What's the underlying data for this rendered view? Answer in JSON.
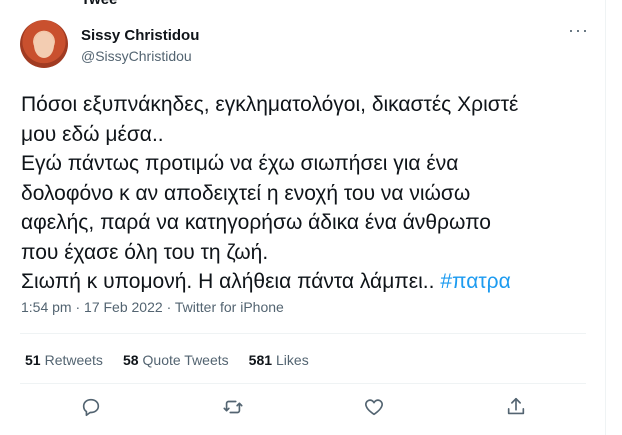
{
  "tweet": {
    "top_cut_text": "Twee",
    "author_name": "Sissy Christidou",
    "author_handle": "@SissyChristidou",
    "body_text": "Πόσοι εξυπνάκηδες, εγκληματολόγοι, δικαστές Χριστέ\nμου εδώ μέσα..\nΕγώ πάντως προτιμώ να έχω σιωπήσει για ένα\nδολοφόνο κ αν αποδειχτεί η ενοχή του να νιώσω\nαφελής, παρά να κατηγορήσω άδικα ένα άνθρωπο\nπου έχασε όλη του τη ζωή.\nΣιωπή κ υπομονή. Η αλήθεια πάντα λάμπει.. ",
    "hashtag": "#πατρα",
    "time": "1:54 pm",
    "separator": "·",
    "date": "17 Feb 2022",
    "source": "Twitter for iPhone",
    "more_glyph": "···"
  },
  "stats": {
    "retweets_count": "51",
    "retweets_label": "Retweets",
    "quotes_count": "58",
    "quotes_label": "Quote Tweets",
    "likes_count": "581",
    "likes_label": "Likes"
  },
  "actions": {
    "icons": [
      "reply-icon",
      "retweet-icon",
      "like-icon",
      "share-icon"
    ]
  },
  "colors": {
    "text": "#0f1419",
    "secondary": "#536471",
    "accent": "#1d9bf0",
    "divider": "#eff3f4"
  }
}
